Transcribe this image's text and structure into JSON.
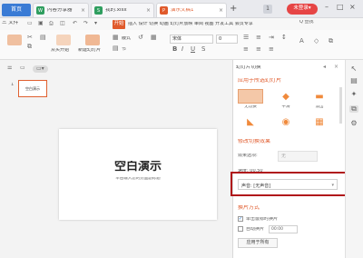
{
  "tabs": {
    "home": "首页",
    "t1": "内容分享器",
    "t2": "我的.xlsx",
    "t3": "演示文稿1",
    "plus": "+",
    "win_num": "1",
    "login": "未登录▾"
  },
  "menu": {
    "file": "三 文件",
    "start": "开始",
    "tabs_rest": "插入 设计 切换 动画 幻灯片放映 审阅 视图 开发工具 会员专享",
    "search": "Q 查找"
  },
  "toolbar": {
    "from_start": "从头开始",
    "new_slide": "新建幻灯片",
    "layout": "版式",
    "section": "节",
    "font_value": "宋体",
    "size_value": "0"
  },
  "left": {
    "tab_outline": "大纲",
    "tab_slides": "幻灯片",
    "thumb_num": "1",
    "thumb_text": "空白演示",
    "slide_title": "空白演示",
    "slide_subtitle": "单击输入您的封面副标题"
  },
  "panel": {
    "title": "幻灯片切换",
    "apply_section": "应用于所选幻灯片",
    "effects": [
      "无切换",
      "平滑",
      "淡出"
    ],
    "modify_section": "修改切换效果",
    "effect_option_label": "效果选项:",
    "effect_option_value": "无",
    "speed_label": "速度: 00.50",
    "sound_label": "声音:",
    "sound_value": "[无声音]",
    "advance_section": "换片方式",
    "on_click": "单击鼠标时换片",
    "auto_after": "自动换片",
    "auto_time": "00:00",
    "apply_all": "应用于所有"
  },
  "colors": {
    "accent": "#e05a2b",
    "highlight": "#b0161a",
    "home_blue": "#3a7bd5"
  }
}
